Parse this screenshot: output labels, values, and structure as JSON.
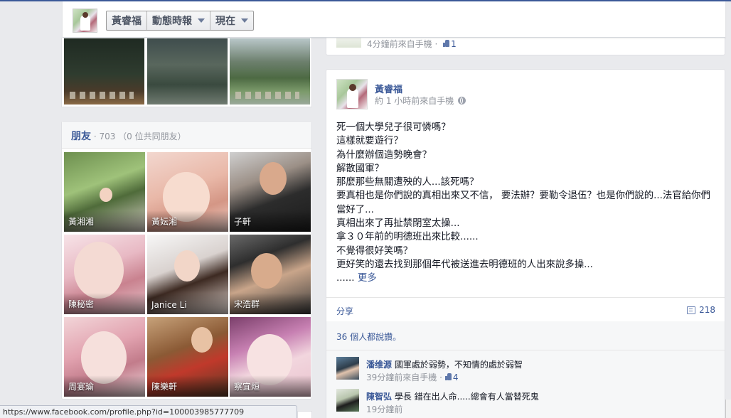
{
  "header": {
    "profile_name": "黃睿福",
    "timeline_label": "動態時報",
    "now_label": "現在"
  },
  "previous_story": {
    "meta": "4分鐘前來自手機",
    "like_count": "1"
  },
  "friends": {
    "title": "朋友",
    "count": " · 703 （0 位共同朋友）",
    "items": [
      {
        "name": "黃湘湘"
      },
      {
        "name": "黃妘湘"
      },
      {
        "name": "子軒"
      },
      {
        "name": "陳秘密"
      },
      {
        "name": "Janice Li"
      },
      {
        "name": "宋浩群"
      },
      {
        "name": "周宴瑜"
      },
      {
        "name": "陳樂軒"
      },
      {
        "name": "察宜烜"
      }
    ]
  },
  "story": {
    "author": "黃睿福",
    "meta": "約 1 小時前來自手機",
    "lines": [
      "死一個大學兒子很可憐嗎？",
      "這樣就要遊行？",
      "為什麼辦個造勢晚會？",
      "解散國軍？",
      "那麼那些無關遭殃的人...該死嗎？",
      "要真相也是你們說的真相出來又不信， 要法辦？要勒令退伍？也是你們說的...法官給你們當好了...",
      "真相出來了再扯禁閉室太操...",
      "拿３０年前的明德班出來比較......",
      "不覺得很好笑嗎？",
      "更好笑的還去找到那個年代被送進去明德班的人出來說多操..."
    ],
    "ellipsis": "......",
    "see_more": "更多",
    "share_label": "分享",
    "comment_count": "218",
    "likes_text": "36 個人都說讚。",
    "comments": [
      {
        "author": "潘维源",
        "text": "國軍處於弱勢，不知情的處於弱智",
        "meta": "39分鐘前來自手機 · ",
        "likes": "4"
      },
      {
        "author": "陳智弘",
        "text": "學長 錯在出人命.....總會有人當替死鬼",
        "meta": "19分鐘前"
      }
    ]
  },
  "status_bar": {
    "url": "https://www.facebook.com/profile.php?id=100003985777709"
  }
}
